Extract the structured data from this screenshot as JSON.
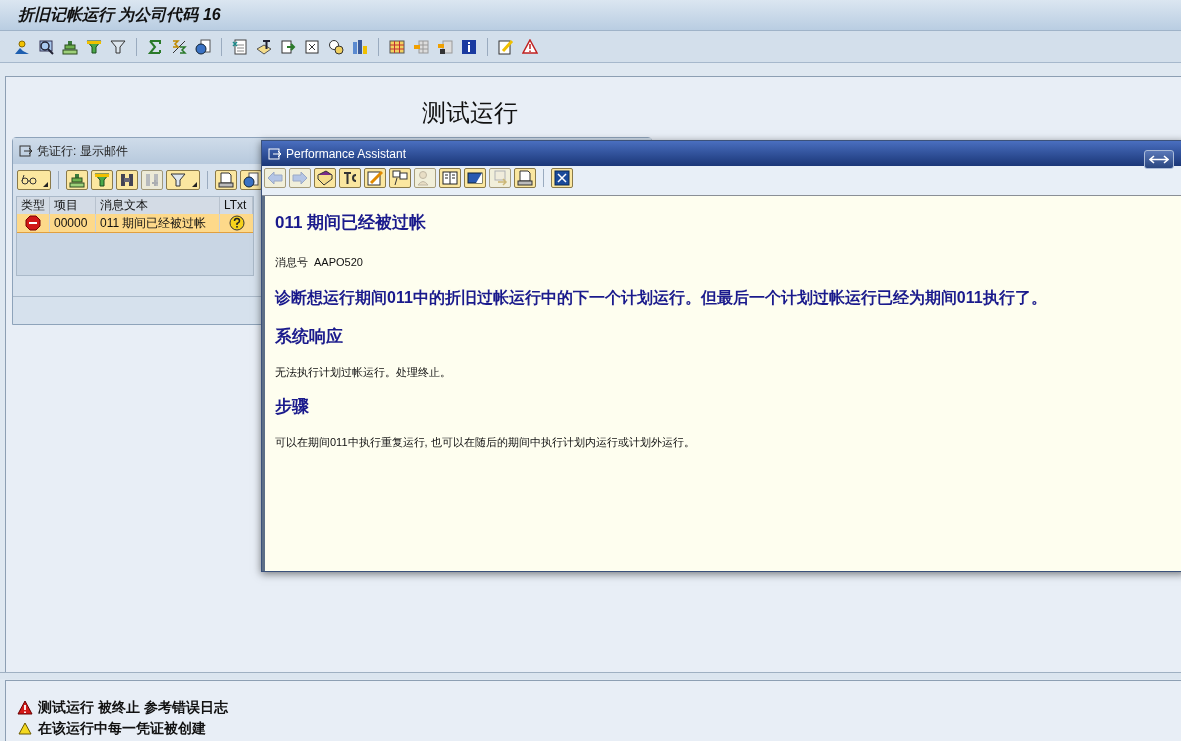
{
  "window": {
    "title": "折旧记帐运行 为公司代码 16"
  },
  "page_heading": "测试运行",
  "message_dialog": {
    "title": "凭证行: 显示邮件",
    "table": {
      "columns": [
        "类型",
        "项目",
        "消息文本",
        "LTxt"
      ],
      "rows": [
        {
          "kind": "error",
          "item": "00000",
          "text": "011 期间已经被过帐",
          "selected": true
        }
      ]
    }
  },
  "performance_assistant": {
    "title": "Performance Assistant",
    "heading": "011 期间已经被过帐",
    "message_number_label": "消息号",
    "message_number": "AAPO520",
    "sections": [
      {
        "kind": "lead",
        "text": "诊断想运行期间011中的折旧过帐运行中的下一个计划运行。但最后一个计划过帐运行已经为期间011执行了。"
      },
      {
        "kind": "heading",
        "text": "系统响应"
      },
      {
        "kind": "body",
        "text": "无法执行计划过帐运行。处理终止。"
      },
      {
        "kind": "heading",
        "text": "步骤"
      },
      {
        "kind": "body",
        "text": "可以在期间011中执行重复运行, 也可以在随后的期间中执行计划内运行或计划外运行。"
      }
    ]
  },
  "status_messages": [
    {
      "kind": "error",
      "text": "测试运行 被终止 参考错误日志"
    },
    {
      "kind": "warning",
      "text": "在该运行中每一凭证被创建"
    }
  ]
}
